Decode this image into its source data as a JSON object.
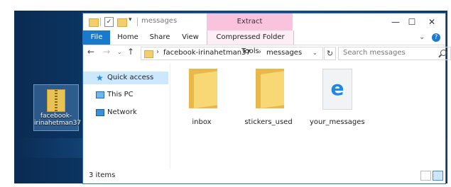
{
  "desktop": {
    "icon_label": "facebook-irinahetman37"
  },
  "window": {
    "title": "messages",
    "qa_arrow": "▾",
    "context_tab": "Extract",
    "controls": {
      "minimize": "—",
      "maximize": "☐",
      "close": "✕"
    },
    "ribbon_tabs": {
      "file": "File",
      "home": "Home",
      "share": "Share",
      "view": "View",
      "context": "Compressed Folder Tools"
    },
    "ribbon_chevron": "⌄",
    "help": "?"
  },
  "address": {
    "back": "←",
    "forward": "→",
    "recent": "⌄",
    "up": "↑",
    "sep1": "›",
    "crumb1": "facebook-irinahetman37",
    "sep2": "›",
    "crumb2": "messages",
    "dropdown": "⌄",
    "refresh": "↻",
    "search_placeholder": "Search messages"
  },
  "nav": {
    "items": [
      {
        "label": "Quick access",
        "icon": "star-icon"
      },
      {
        "label": "This PC",
        "icon": "computer-icon"
      },
      {
        "label": "Network",
        "icon": "network-icon"
      }
    ]
  },
  "files": [
    {
      "name": "inbox",
      "type": "folder"
    },
    {
      "name": "stickers_used",
      "type": "folder"
    },
    {
      "name": "your_messages",
      "type": "html-document",
      "icon": "edge-icon"
    }
  ],
  "status": {
    "count": "3 items"
  }
}
